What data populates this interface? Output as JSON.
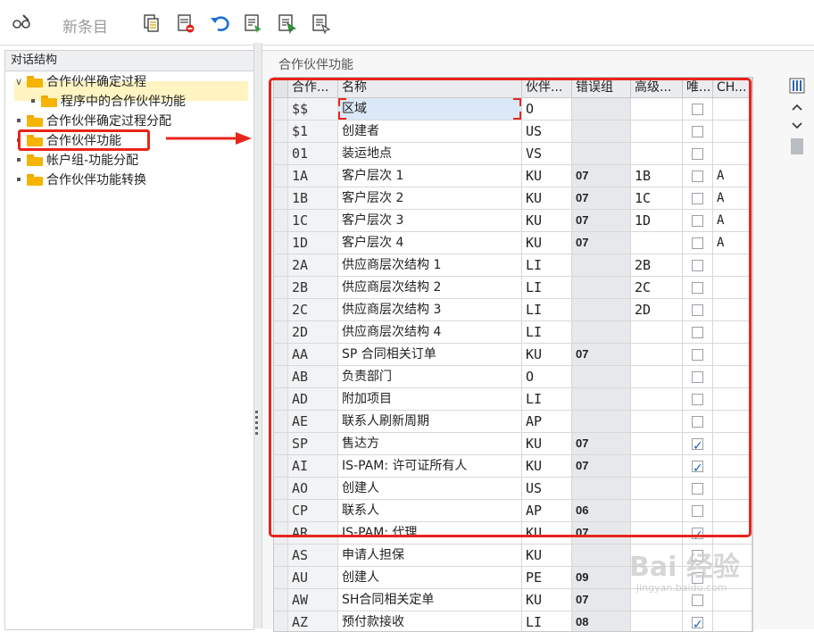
{
  "toolbar": {
    "new_entries": "新条目"
  },
  "tree": {
    "title": "对话结构",
    "nodes": [
      {
        "label": "合作伙伴确定过程",
        "level": 0,
        "expanded": true
      },
      {
        "label": "程序中的合作伙伴功能",
        "level": 1
      },
      {
        "label": "合作伙伴确定过程分配",
        "level": 0
      },
      {
        "label": "合作伙伴功能",
        "level": 0,
        "selected": true
      },
      {
        "label": "帐户组-功能分配",
        "level": 0
      },
      {
        "label": "合作伙伴功能转换",
        "level": 0
      }
    ]
  },
  "panel": {
    "title": "合作伙伴功能"
  },
  "table": {
    "columns": [
      "合作...",
      "名称",
      "伙伴...",
      "错误组",
      "高级...",
      "唯...",
      "CH..."
    ],
    "rows": [
      {
        "code": "$$",
        "name": "区域",
        "type": "O",
        "err": "",
        "hi": "",
        "uniq": false,
        "ch": ""
      },
      {
        "code": "$1",
        "name": "创建者",
        "type": "US",
        "err": "",
        "hi": "",
        "uniq": false,
        "ch": ""
      },
      {
        "code": "01",
        "name": "装运地点",
        "type": "VS",
        "err": "",
        "hi": "",
        "uniq": false,
        "ch": ""
      },
      {
        "code": "1A",
        "name": "客户层次 1",
        "type": "KU",
        "err": "07",
        "hi": "1B",
        "uniq": false,
        "ch": "A"
      },
      {
        "code": "1B",
        "name": "客户层次 2",
        "type": "KU",
        "err": "07",
        "hi": "1C",
        "uniq": false,
        "ch": "A"
      },
      {
        "code": "1C",
        "name": "客户层次 3",
        "type": "KU",
        "err": "07",
        "hi": "1D",
        "uniq": false,
        "ch": "A"
      },
      {
        "code": "1D",
        "name": "客户层次 4",
        "type": "KU",
        "err": "07",
        "hi": "",
        "uniq": false,
        "ch": "A"
      },
      {
        "code": "2A",
        "name": "供应商层次结构 1",
        "type": "LI",
        "err": "",
        "hi": "2B",
        "uniq": false,
        "ch": ""
      },
      {
        "code": "2B",
        "name": "供应商层次结构 2",
        "type": "LI",
        "err": "",
        "hi": "2C",
        "uniq": false,
        "ch": ""
      },
      {
        "code": "2C",
        "name": "供应商层次结构 3",
        "type": "LI",
        "err": "",
        "hi": "2D",
        "uniq": false,
        "ch": ""
      },
      {
        "code": "2D",
        "name": "供应商层次结构 4",
        "type": "LI",
        "err": "",
        "hi": "",
        "uniq": false,
        "ch": ""
      },
      {
        "code": "AA",
        "name": "SP 合同相关订单",
        "type": "KU",
        "err": "07",
        "hi": "",
        "uniq": false,
        "ch": ""
      },
      {
        "code": "AB",
        "name": "负责部门",
        "type": "O",
        "err": "",
        "hi": "",
        "uniq": false,
        "ch": ""
      },
      {
        "code": "AD",
        "name": "附加项目",
        "type": "LI",
        "err": "",
        "hi": "",
        "uniq": false,
        "ch": ""
      },
      {
        "code": "AE",
        "name": "联系人刷新周期",
        "type": "AP",
        "err": "",
        "hi": "",
        "uniq": false,
        "ch": ""
      },
      {
        "code": "SP",
        "name": "售达方",
        "type": "KU",
        "err": "07",
        "hi": "",
        "uniq": true,
        "ch": ""
      },
      {
        "code": "AI",
        "name": "IS-PAM: 许可证所有人",
        "type": "KU",
        "err": "07",
        "hi": "",
        "uniq": true,
        "ch": ""
      },
      {
        "code": "AO",
        "name": "创建人",
        "type": "US",
        "err": "",
        "hi": "",
        "uniq": false,
        "ch": ""
      },
      {
        "code": "CP",
        "name": "联系人",
        "type": "AP",
        "err": "06",
        "hi": "",
        "uniq": false,
        "ch": ""
      },
      {
        "code": "AR",
        "name": "IS-PAM: 代理",
        "type": "KU",
        "err": "07",
        "hi": "",
        "uniq": true,
        "ch": ""
      },
      {
        "code": "AS",
        "name": "申请人担保",
        "type": "KU",
        "err": "",
        "hi": "",
        "uniq": false,
        "ch": ""
      },
      {
        "code": "AU",
        "name": "创建人",
        "type": "PE",
        "err": "09",
        "hi": "",
        "uniq": false,
        "ch": ""
      },
      {
        "code": "AW",
        "name": "SH合同相关定单",
        "type": "KU",
        "err": "07",
        "hi": "",
        "uniq": false,
        "ch": ""
      },
      {
        "code": "AZ",
        "name": "预付款接收",
        "type": "LI",
        "err": "08",
        "hi": "",
        "uniq": true,
        "ch": ""
      }
    ]
  },
  "watermark": {
    "brand": "Bai 经验",
    "url": "jingyan.baidu.com"
  },
  "colors": {
    "accent": "#e8251c",
    "check": "#1f5fbf",
    "folder": "#f5b400",
    "selection": "#fff4c2"
  }
}
